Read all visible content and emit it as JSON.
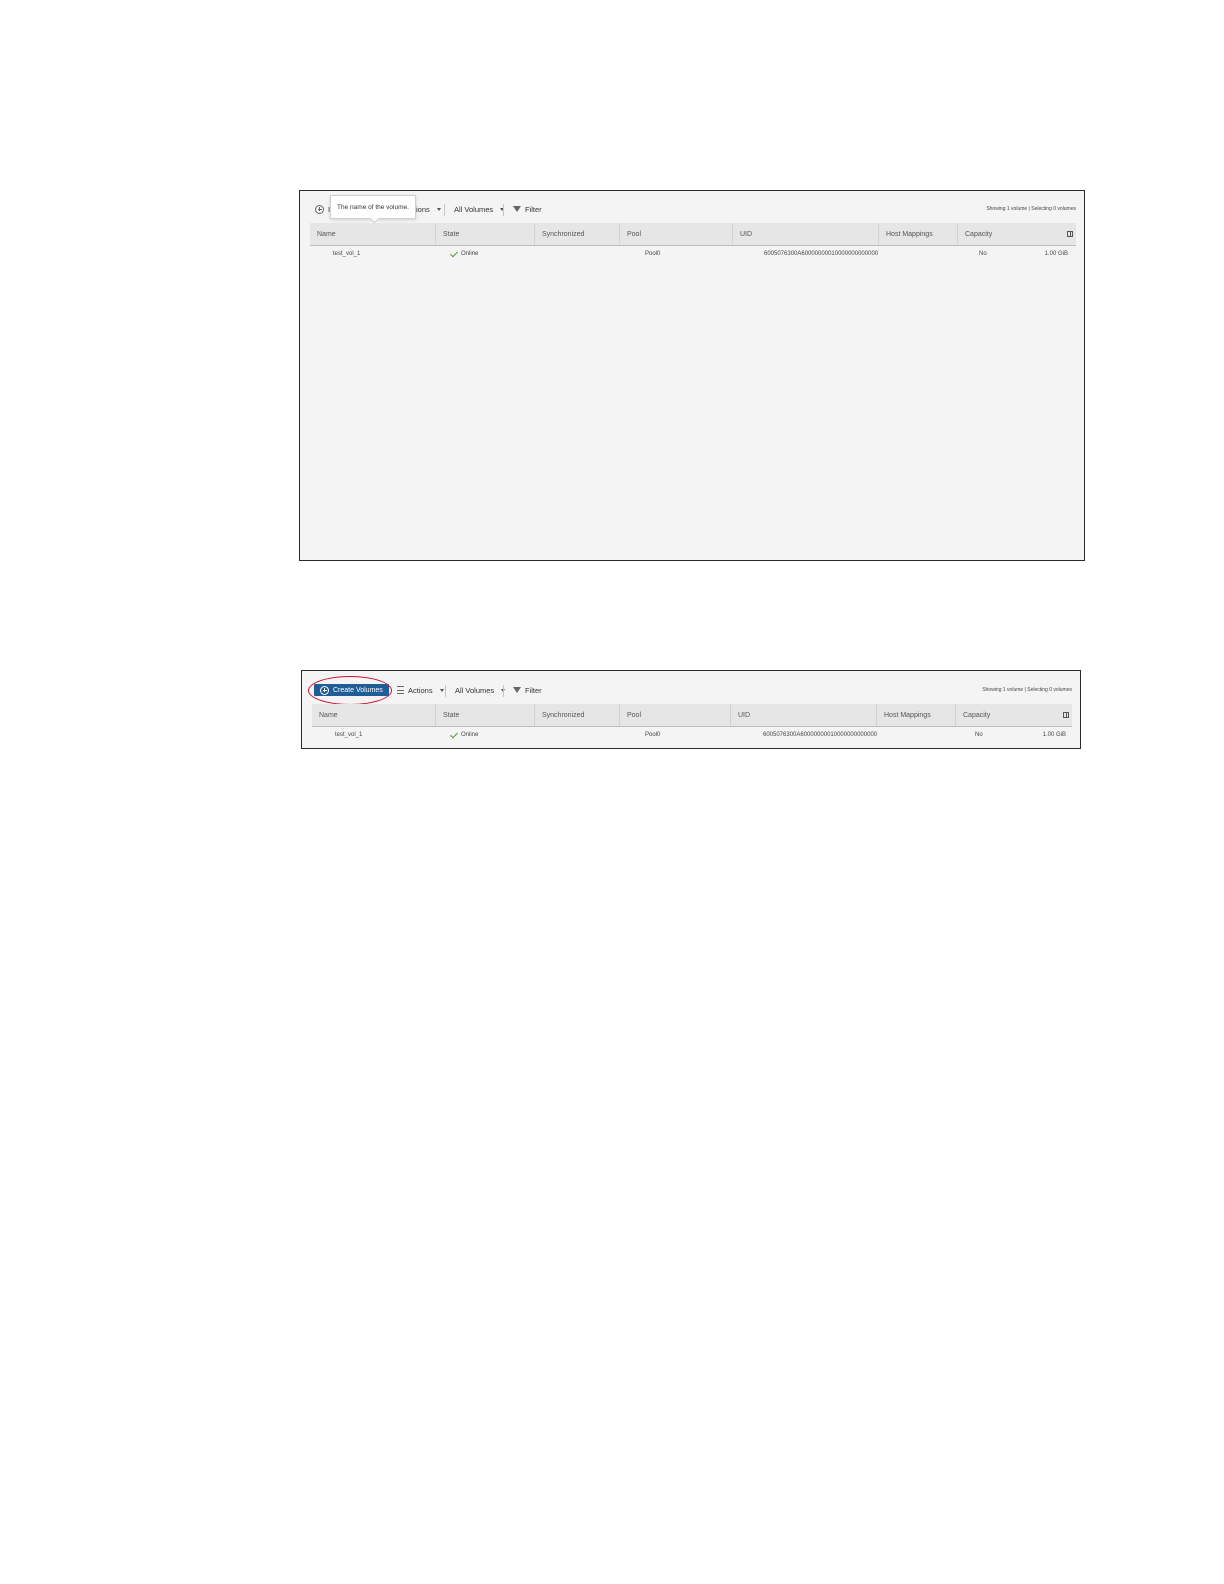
{
  "screenshot1": {
    "tooltip": "The name of the volume.",
    "toolbar": {
      "create_label_partial": "I",
      "actions_label_partial": "ions",
      "view_label": "All Volumes",
      "filter_label": "Filter",
      "status": "Showing 1 volume | Selecting 0 volumes"
    },
    "columns": [
      "Name",
      "State",
      "Synchronized",
      "Pool",
      "UID",
      "Host Mappings",
      "Capacity"
    ],
    "rows": [
      {
        "name": "test_vol_1",
        "state": "Online",
        "synchronized": "",
        "pool": "Pool0",
        "uid": "6005076300A60000000010000000000000",
        "host_mappings": "No",
        "capacity": "1.00 GiB"
      }
    ]
  },
  "screenshot2": {
    "toolbar": {
      "create_label": "Create Volumes",
      "actions_label": "Actions",
      "view_label": "All Volumes",
      "filter_label": "Filter",
      "status": "Showing 1 volume | Selecting 0 volumes"
    },
    "columns": [
      "Name",
      "State",
      "Synchronized",
      "Pool",
      "UID",
      "Host Mappings",
      "Capacity"
    ],
    "rows": [
      {
        "name": "test_vol_1",
        "state": "Online",
        "synchronized": "",
        "pool": "Pool0",
        "uid": "6005076300A60000000010000000000000",
        "host_mappings": "No",
        "capacity": "1.00 GiB"
      }
    ]
  },
  "colors": {
    "accent": "#1f5d96",
    "highlight": "#c8102e",
    "online": "#4a9a2a"
  }
}
